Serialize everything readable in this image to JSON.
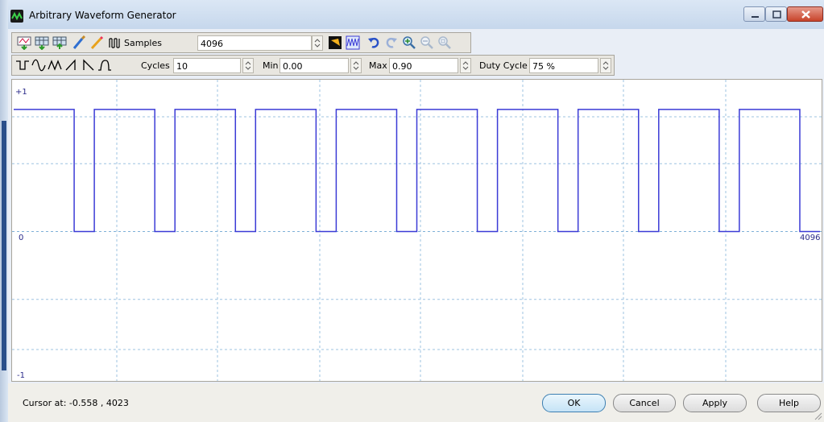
{
  "window": {
    "title": "Arbitrary Waveform Generator",
    "accent_color": "#3b3bd6"
  },
  "toolbar1": {
    "icons": [
      "import-waveform-icon",
      "insert-table-icon",
      "export-table-icon",
      "brush-icon",
      "pencil-icon",
      "samples-icon"
    ],
    "samples_label": "Samples",
    "samples_value": "4096",
    "right_icons": [
      "color-fill-icon",
      "waveform-view-icon",
      "undo-icon",
      "redo-icon",
      "zoom-in-icon",
      "zoom-out-icon",
      "zoom-fit-icon"
    ]
  },
  "toolbar2": {
    "shape_icons": [
      "square-wave-icon",
      "sine-wave-icon",
      "triangle-wave-icon",
      "ramp-up-icon",
      "ramp-down-icon",
      "pulse-icon"
    ],
    "cycles_label": "Cycles",
    "cycles_value": "10",
    "min_label": "Min",
    "min_value": "0.00",
    "max_label": "Max",
    "max_value": "0.90",
    "duty_label": "Duty Cycle",
    "duty_value": "75 %"
  },
  "plot": {
    "y_top_label": "+1",
    "y_mid_label": "0",
    "y_bottom_label": "-1",
    "x_end_label": "4096",
    "waveform": {
      "cycles": 10,
      "duty_cycle": 0.75,
      "samples": 4096,
      "high": 0.9,
      "low": 0.0
    }
  },
  "status": {
    "cursor_text": "Cursor at: -0.558 , 4023"
  },
  "buttons": {
    "ok": "OK",
    "cancel": "Cancel",
    "apply": "Apply",
    "help": "Help"
  }
}
